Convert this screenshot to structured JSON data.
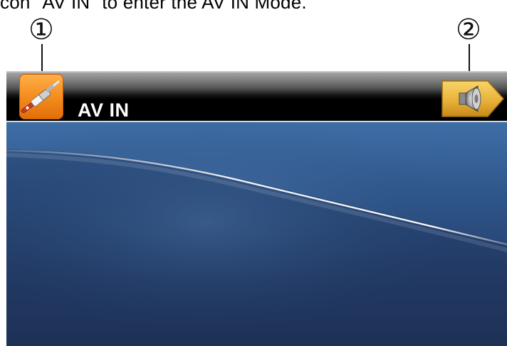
{
  "caption": "con \"AV IN\" to enter the AV IN Mode.",
  "callouts": {
    "one": "①",
    "two": "②"
  },
  "titlebar": {
    "title": "AV IN",
    "left_icon": "av-cable-icon",
    "right_icon": "speaker-volume-icon"
  },
  "colors": {
    "icon_orange": "#f28a1c",
    "volume_gold": "#e8b23a",
    "screen_blue": "#1f3a63",
    "titlebar_black": "#000000"
  }
}
